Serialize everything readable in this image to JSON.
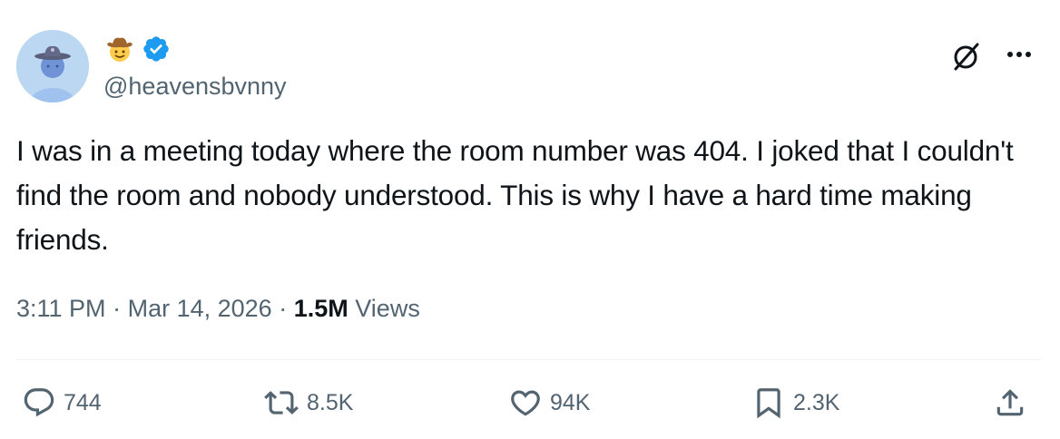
{
  "author": {
    "handle": "@heavensbvnny",
    "name_emoji": "cowboy-hat-face",
    "verified": true,
    "verified_color": "#1d9bf0"
  },
  "tweet": {
    "text": "I was in a meeting today where the room number was 404. I joked that I couldn't find the room and nobody understood. This is why I have a hard time making friends.",
    "time": "3:11 PM",
    "separator": "·",
    "date": "Mar 14, 2026",
    "views_count": "1.5M",
    "views_label": "Views"
  },
  "actions": {
    "replies": "744",
    "retweets": "8.5K",
    "likes": "94K",
    "bookmarks": "2.3K"
  },
  "icons": {
    "grok": "grok-icon",
    "more": "more-icon",
    "reply": "reply-icon",
    "retweet": "retweet-icon",
    "like": "heart-icon",
    "bookmark": "bookmark-icon",
    "share": "share-icon"
  },
  "colors": {
    "text_primary": "#0f1419",
    "text_secondary": "#536471",
    "accent": "#1d9bf0"
  }
}
